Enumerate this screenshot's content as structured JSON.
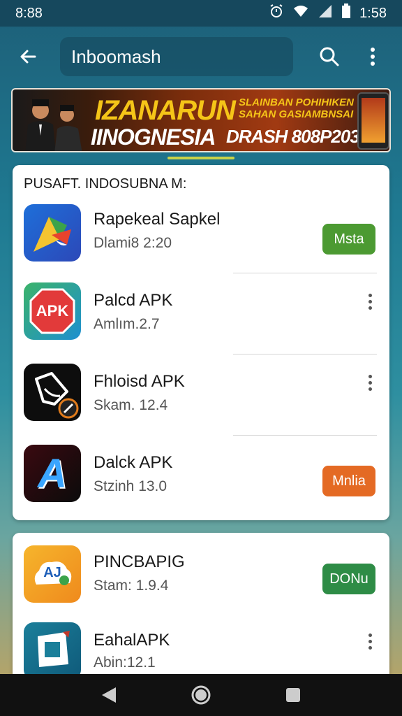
{
  "status_bar": {
    "time_left": "8:88",
    "time_right": "1:58"
  },
  "app_bar": {
    "search_text": "Inboomash"
  },
  "banner": {
    "headline_1": "IZANARUN",
    "headline_2": "IINOGNESIA",
    "sub_1": "SLAINBAN POHIHIKEN SAHAN GASIAMBNSAI",
    "sub_2": "DRASH 808P203"
  },
  "section": {
    "title": "PUSAFT. INDOSUBNA M:"
  },
  "apps": [
    {
      "name": "Rapekeal Sapkel",
      "sub": "Dlami8 2:20",
      "action": "Msta",
      "action_color": "#4c9a32",
      "icon": "maps-style-icon"
    },
    {
      "name": "Palcd APK",
      "sub": "Amlım.2.7",
      "action": "",
      "icon": "apk-badge-icon"
    },
    {
      "name": "Fhloisd APK",
      "sub": "Skam. 12.4",
      "action": "",
      "icon": "leaf-outline-icon"
    },
    {
      "name": "Dalck APK",
      "sub": "Stzinh 13.0",
      "action": "Mnlia",
      "action_color": "#e46a24",
      "icon": "letter-a-icon"
    }
  ],
  "apps_2": [
    {
      "name": "PINCBAPIG",
      "sub": "Stam: 1.9.4",
      "action": "DONu",
      "action_color": "#2e8c46",
      "icon": "chat-cloud-icon"
    },
    {
      "name": "EahalAPK",
      "sub": "Abin:12.1",
      "action": "",
      "icon": "square-frame-icon"
    }
  ],
  "icon_apk_text": "APK",
  "icon_a_text": "A",
  "icon_chat_text": "AJ"
}
